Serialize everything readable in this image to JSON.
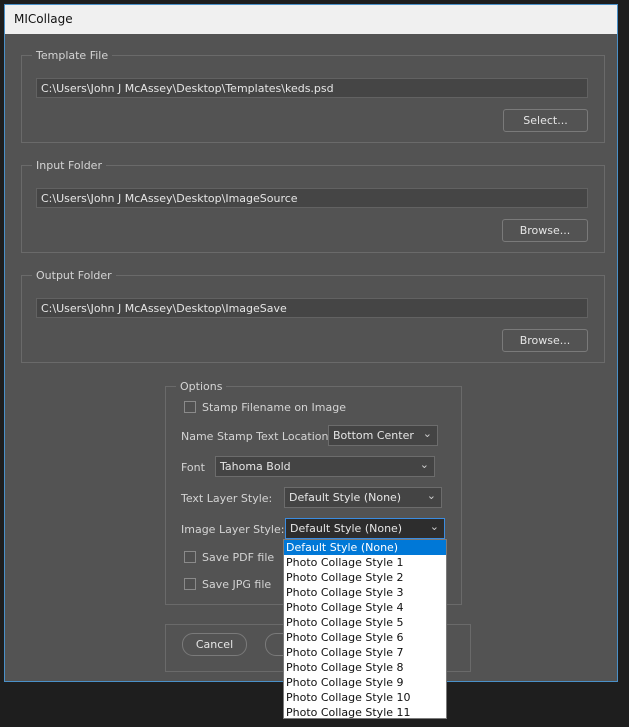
{
  "window": {
    "title": "MICollage"
  },
  "template": {
    "legend": "Template File",
    "path": "C:\\Users\\John J McAssey\\Desktop\\Templates\\keds.psd",
    "button": "Select..."
  },
  "input": {
    "legend": "Input Folder",
    "path": "C:\\Users\\John J McAssey\\Desktop\\ImageSource",
    "button": "Browse..."
  },
  "output": {
    "legend": "Output Folder",
    "path": "C:\\Users\\John J McAssey\\Desktop\\ImageSave",
    "button": "Browse..."
  },
  "options": {
    "legend": "Options",
    "stamp_filename": {
      "label": "Stamp Filename on Image",
      "checked": false
    },
    "stamp_location": {
      "label": "Name Stamp Text  Location:",
      "value": "Bottom Center"
    },
    "font": {
      "label": "Font",
      "value": "Tahoma Bold"
    },
    "text_layer_style": {
      "label": "Text Layer Style:",
      "value": "Default Style (None)"
    },
    "image_layer_style": {
      "label": "Image Layer Style:",
      "value": "Default Style (None)",
      "options": [
        "Default Style (None)",
        "Photo Collage Style 1",
        "Photo Collage Style 2",
        "Photo Collage Style 3",
        "Photo Collage Style 4",
        "Photo Collage Style 5",
        "Photo Collage Style 6",
        "Photo Collage Style 7",
        "Photo Collage Style 8",
        "Photo Collage Style 9",
        "Photo Collage Style 10",
        "Photo Collage Style 11"
      ]
    },
    "save_pdf": {
      "label": "Save PDF file",
      "checked": false
    },
    "save_jpg": {
      "label": "Save JPG file",
      "checked": false
    }
  },
  "footer": {
    "cancel": "Cancel"
  }
}
